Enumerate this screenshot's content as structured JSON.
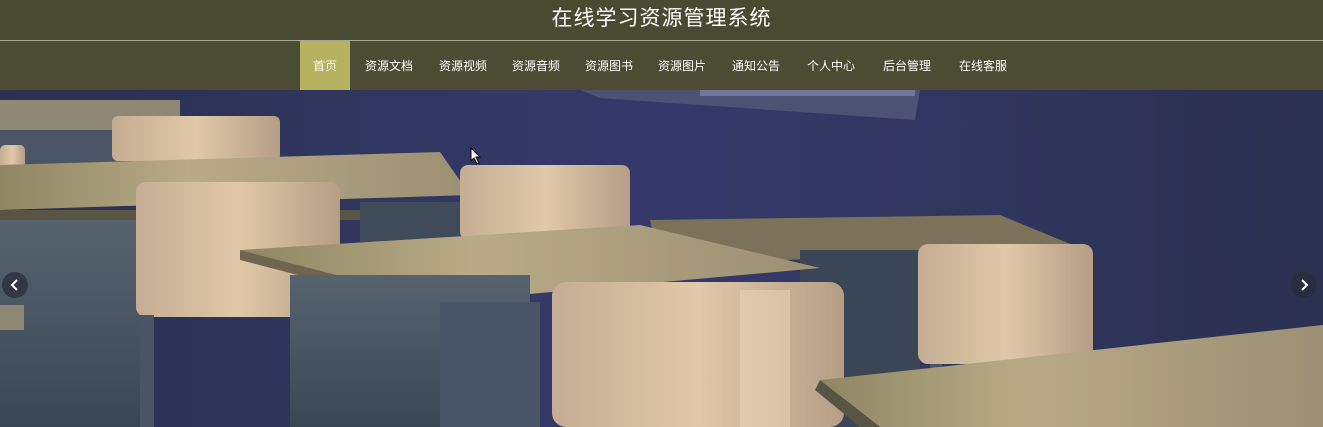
{
  "header": {
    "title": "在线学习资源管理系统"
  },
  "nav": {
    "items": [
      {
        "label": "首页",
        "active": true
      },
      {
        "label": "资源文档",
        "active": false
      },
      {
        "label": "资源视频",
        "active": false
      },
      {
        "label": "资源音频",
        "active": false
      },
      {
        "label": "资源图书",
        "active": false
      },
      {
        "label": "资源图片",
        "active": false
      },
      {
        "label": "通知公告",
        "active": false
      },
      {
        "label": "个人中心",
        "active": false
      },
      {
        "label": "后台管理",
        "active": false
      },
      {
        "label": "在线客服",
        "active": false
      }
    ]
  },
  "carousel": {
    "prev_icon": "chevron-left-icon",
    "next_icon": "chevron-right-icon"
  },
  "colors": {
    "header_bg": "#484a32",
    "nav_bg": "#4b4c33",
    "nav_active_bg": "#b7b260",
    "text": "#ffffff"
  }
}
